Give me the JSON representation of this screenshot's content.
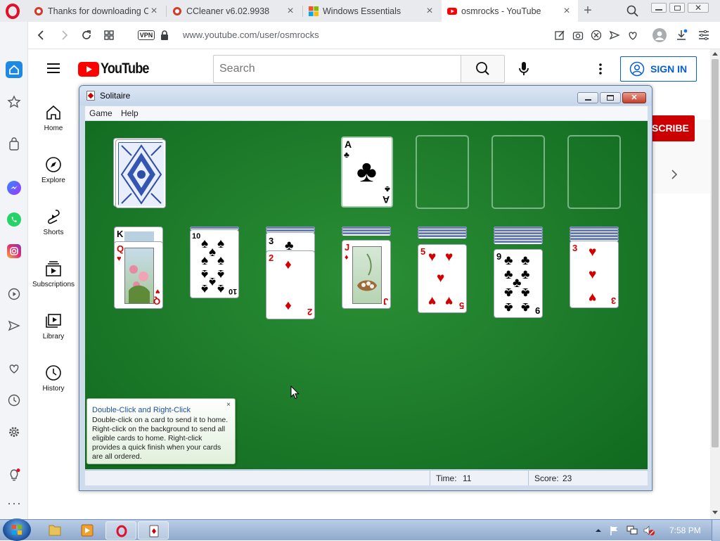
{
  "browser": {
    "tabs": [
      {
        "title": "Thanks for downloading C"
      },
      {
        "title": "CCleaner v6.02.9938"
      },
      {
        "title": "Windows Essentials"
      },
      {
        "title": "osmrocks - YouTube"
      }
    ],
    "new_tab": "+",
    "vpn_badge": "VPN",
    "url": "www.youtube.com/user/osmrocks"
  },
  "youtube": {
    "logo_text": "YouTube",
    "search_placeholder": "Search",
    "sign_in": "SIGN IN",
    "subscribe_fragment": "SCRIBE",
    "nav": [
      {
        "label": "Home",
        "icon": "home-icon"
      },
      {
        "label": "Explore",
        "icon": "compass-icon"
      },
      {
        "label": "Shorts",
        "icon": "shorts-icon"
      },
      {
        "label": "Subscriptions",
        "icon": "subscriptions-icon"
      },
      {
        "label": "Library",
        "icon": "library-icon"
      },
      {
        "label": "History",
        "icon": "history-icon"
      }
    ]
  },
  "solitaire": {
    "title": "Solitaire",
    "menu": [
      "Game",
      "Help"
    ],
    "foundation_ace": {
      "rank": "A",
      "suit": "♣"
    },
    "tableau": [
      {
        "top_rank": "Q",
        "top_suit": "♥",
        "peek_rank": "K"
      },
      {
        "top_rank": "10",
        "top_suit": "♠"
      },
      {
        "top_rank": "2",
        "top_suit": "♦",
        "peek_rank": "3",
        "peek_suit": "♣"
      },
      {
        "top_rank": "J",
        "top_suit": "♦"
      },
      {
        "top_rank": "5",
        "top_suit": "♥"
      },
      {
        "top_rank": "9",
        "top_suit": "♣"
      },
      {
        "top_rank": "3",
        "top_suit": "♥"
      }
    ],
    "tip": {
      "title": "Double-Click and Right-Click",
      "body": "Double-click on a card to send it to home. Right-click on the background to send all eligible cards to home. Right-click provides a quick finish when your cards are all ordered."
    },
    "status": {
      "time_label": "Time:",
      "time_value": "11",
      "score_label": "Score:",
      "score_value": "23"
    }
  },
  "taskbar": {
    "clock": "7:58 PM"
  },
  "colors": {
    "youtube_red": "#ff0000",
    "felt_green": "#1d7a2a",
    "sign_in_blue": "#065fd4"
  }
}
